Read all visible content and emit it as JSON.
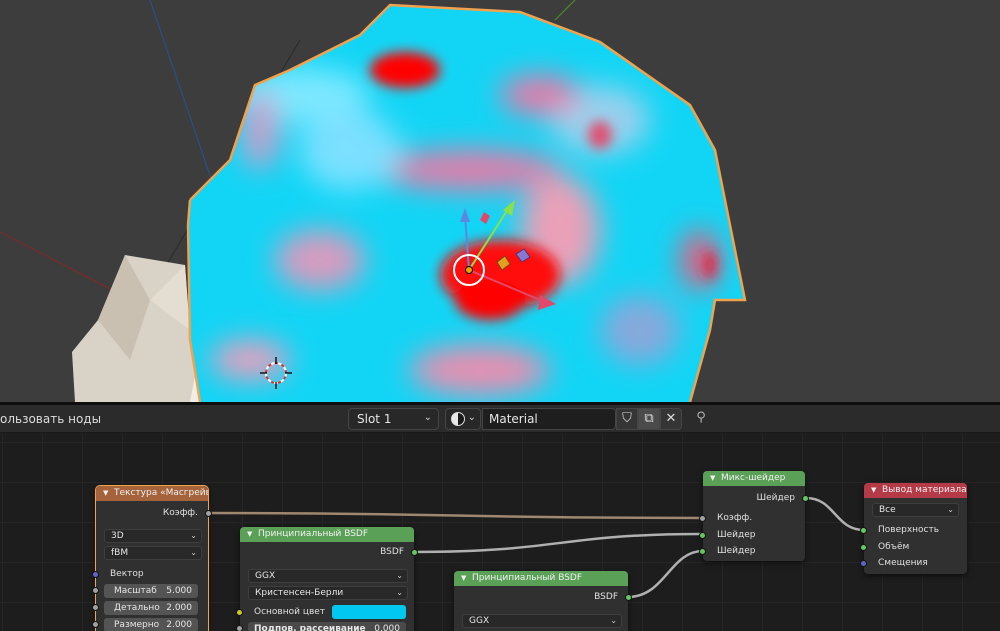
{
  "header": {
    "use_nodes_label": "ользовать ноды",
    "slot_value": "Slot 1",
    "material_name": "Material",
    "icons": {
      "fake_user": "shield-icon",
      "duplicate": "duplicate-icon",
      "unlink": "close-icon",
      "pin": "pin-icon"
    }
  },
  "glyphs": {
    "chevron": "⌄",
    "triangle": "▼",
    "close": "✕",
    "shield": "⛉",
    "duplicate": "⧉",
    "pin": "⚲"
  },
  "colors": {
    "viewport_bg": "#3d3d3d",
    "selection_outline": "#f0a24d",
    "texture_header": "#a5633b",
    "shader_header": "#5aa056",
    "output_header": "#b33a46",
    "sphere_cyan": "#00c8f0",
    "sphere_red": "#ff0000"
  },
  "nodes": {
    "musgrave": {
      "title": "Текстура «Маcгрейв»",
      "output_fac": "Коэфф.",
      "dimensions": "3D",
      "type": "fBM",
      "input_vector": "Вектор",
      "fields": [
        {
          "label": "Масштаб",
          "value": "5.000"
        },
        {
          "label": "Детально",
          "value": "2.000"
        },
        {
          "label": "Размерно",
          "value": "2.000"
        }
      ]
    },
    "bsdf1": {
      "title": "Принципиальный BSDF",
      "output_bsdf": "BSDF",
      "distribution": "GGX",
      "subsurface_method": "Кристенсен-Берли",
      "base_color_label": "Основной цвет",
      "subsurface_label": "Подпов. рассеивание",
      "subsurface_value": "0.000"
    },
    "bsdf2": {
      "title": "Принципиальный BSDF",
      "output_bsdf": "BSDF",
      "distribution": "GGX"
    },
    "mix": {
      "title": "Микс-шейдер",
      "output_shader": "Шейдер",
      "input_fac": "Коэфф.",
      "input_shader1": "Шейдер",
      "input_shader2": "Шейдер"
    },
    "output": {
      "title": "Вывод материала",
      "target": "Все",
      "input_surface": "Поверхность",
      "input_volume": "Объём",
      "input_displacement": "Смещения"
    }
  }
}
